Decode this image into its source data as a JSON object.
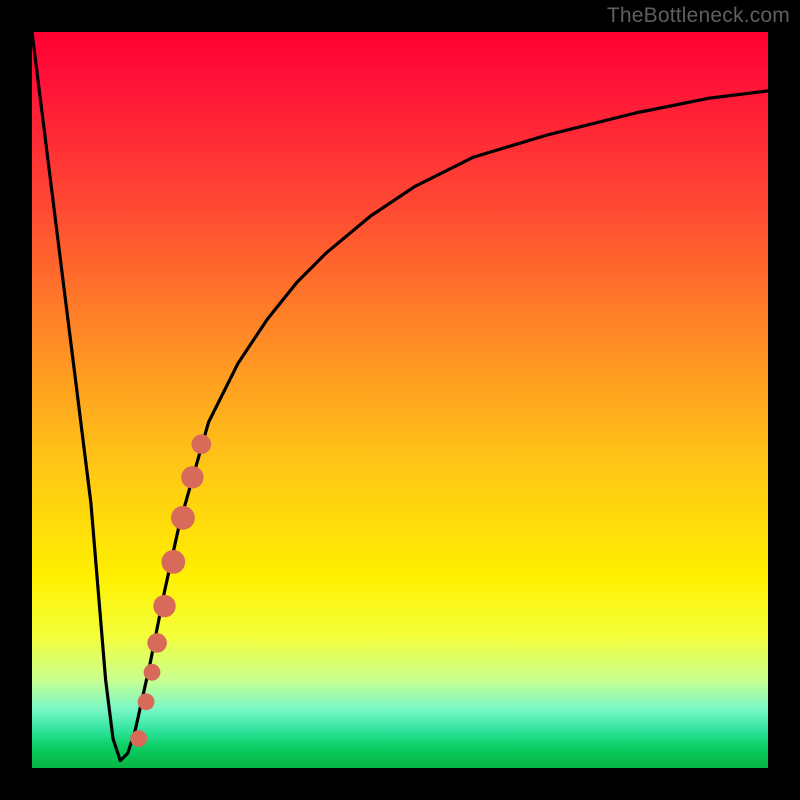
{
  "watermark": "TheBottleneck.com",
  "colors": {
    "curve": "#000000",
    "marker": "#d86a5a",
    "frame": "#000000"
  },
  "chart_data": {
    "type": "line",
    "title": "",
    "xlabel": "",
    "ylabel": "",
    "xlim": [
      0,
      100
    ],
    "ylim": [
      0,
      100
    ],
    "grid": false,
    "series": [
      {
        "name": "bottleneck-curve",
        "x": [
          0,
          2,
          4,
          6,
          8,
          10,
          11,
          12,
          13,
          14,
          16,
          18,
          20,
          24,
          28,
          32,
          36,
          40,
          46,
          52,
          60,
          70,
          82,
          92,
          100
        ],
        "y": [
          100,
          84,
          68,
          52,
          36,
          12,
          4,
          1,
          2,
          5,
          14,
          24,
          33,
          47,
          55,
          61,
          66,
          70,
          75,
          79,
          83,
          86,
          89,
          91,
          92
        ]
      }
    ],
    "markers": [
      {
        "x": 14.5,
        "y": 4.0,
        "r": 1.2
      },
      {
        "x": 15.5,
        "y": 9.0,
        "r": 1.2
      },
      {
        "x": 16.3,
        "y": 13.0,
        "r": 1.2
      },
      {
        "x": 17.0,
        "y": 17.0,
        "r": 1.4
      },
      {
        "x": 18.0,
        "y": 22.0,
        "r": 1.6
      },
      {
        "x": 19.2,
        "y": 28.0,
        "r": 1.7
      },
      {
        "x": 20.5,
        "y": 34.0,
        "r": 1.7
      },
      {
        "x": 21.8,
        "y": 39.5,
        "r": 1.6
      },
      {
        "x": 23.0,
        "y": 44.0,
        "r": 1.4
      }
    ]
  }
}
